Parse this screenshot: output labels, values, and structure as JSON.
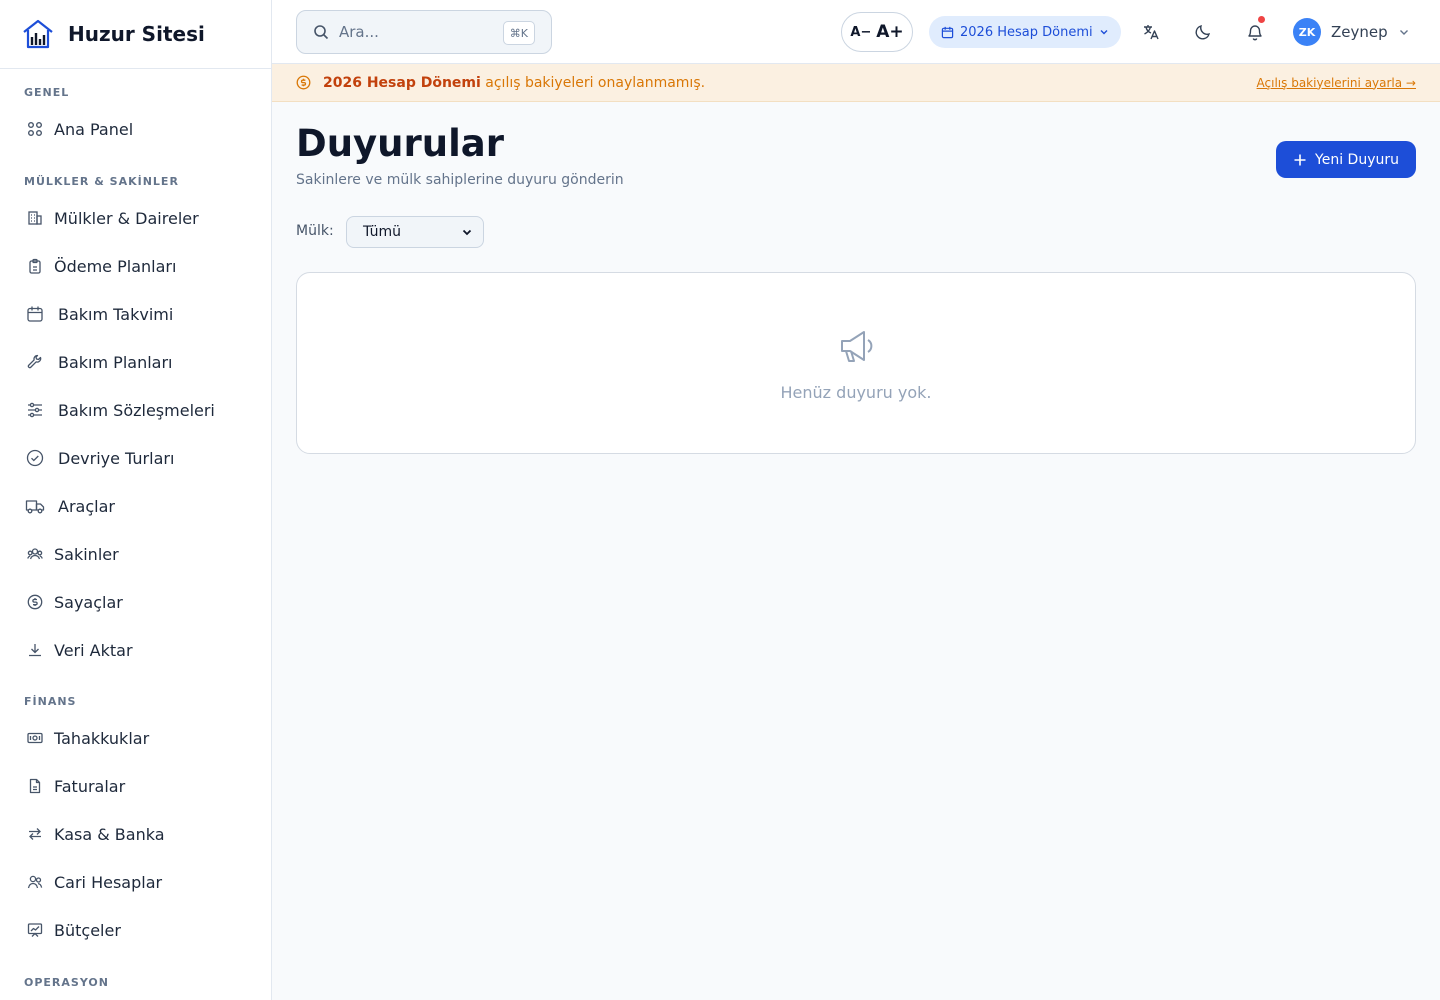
{
  "brand": {
    "name": "Huzur Sitesi"
  },
  "sidebar": {
    "sections": [
      {
        "title": "GENEL",
        "items": [
          {
            "label": "Ana Panel",
            "icon": "grid-icon"
          }
        ]
      },
      {
        "title": "MÜLKLER & SAKİNLER",
        "items": [
          {
            "label": "Mülkler & Daireler",
            "icon": "building-icon"
          },
          {
            "label": "Ödeme Planları",
            "icon": "clipboard-icon"
          },
          {
            "label": "Bakım Takvimi",
            "icon": "calendar-icon"
          },
          {
            "label": "Bakım Planları",
            "icon": "wrench-icon"
          },
          {
            "label": "Bakım Sözleşmeleri",
            "icon": "sliders-icon"
          },
          {
            "label": "Devriye Turları",
            "icon": "check-circle-icon"
          },
          {
            "label": "Araçlar",
            "icon": "truck-icon"
          },
          {
            "label": "Sakinler",
            "icon": "users-icon"
          },
          {
            "label": "Sayaçlar",
            "icon": "dollar-circle-icon"
          },
          {
            "label": "Veri Aktar",
            "icon": "download-icon"
          }
        ]
      },
      {
        "title": "FİNANS",
        "items": [
          {
            "label": "Tahakkuklar",
            "icon": "banknote-icon"
          },
          {
            "label": "Faturalar",
            "icon": "file-icon"
          },
          {
            "label": "Kasa & Banka",
            "icon": "arrows-icon"
          },
          {
            "label": "Cari Hesaplar",
            "icon": "contacts-icon"
          },
          {
            "label": "Bütçeler",
            "icon": "chart-board-icon"
          }
        ]
      },
      {
        "title": "OPERASYON",
        "items": []
      }
    ]
  },
  "topbar": {
    "search_placeholder": "Ara...",
    "search_shortcut": "⌘K",
    "font_decrease": "A−",
    "font_increase": "A+",
    "period_label": "2026 Hesap Dönemi",
    "user_initials": "ZK",
    "user_name": "Zeynep"
  },
  "banner": {
    "bold": "2026 Hesap Dönemi",
    "text": " açılış bakiyeleri onaylanmamış.",
    "link": "Açılış bakiyelerini ayarla →"
  },
  "page": {
    "title": "Duyurular",
    "subtitle": "Sakinlere ve mülk sahiplerine duyuru gönderin",
    "new_button": "Yeni Duyuru",
    "filter_label": "Mülk:",
    "filter_value": "Tümü",
    "empty_text": "Henüz duyuru yok."
  },
  "colors": {
    "primary": "#1d4ed8",
    "banner_bg": "#fbf0e1",
    "banner_text": "#d97706",
    "avatar": "#3b82f6",
    "notification_dot": "#ef4444"
  }
}
